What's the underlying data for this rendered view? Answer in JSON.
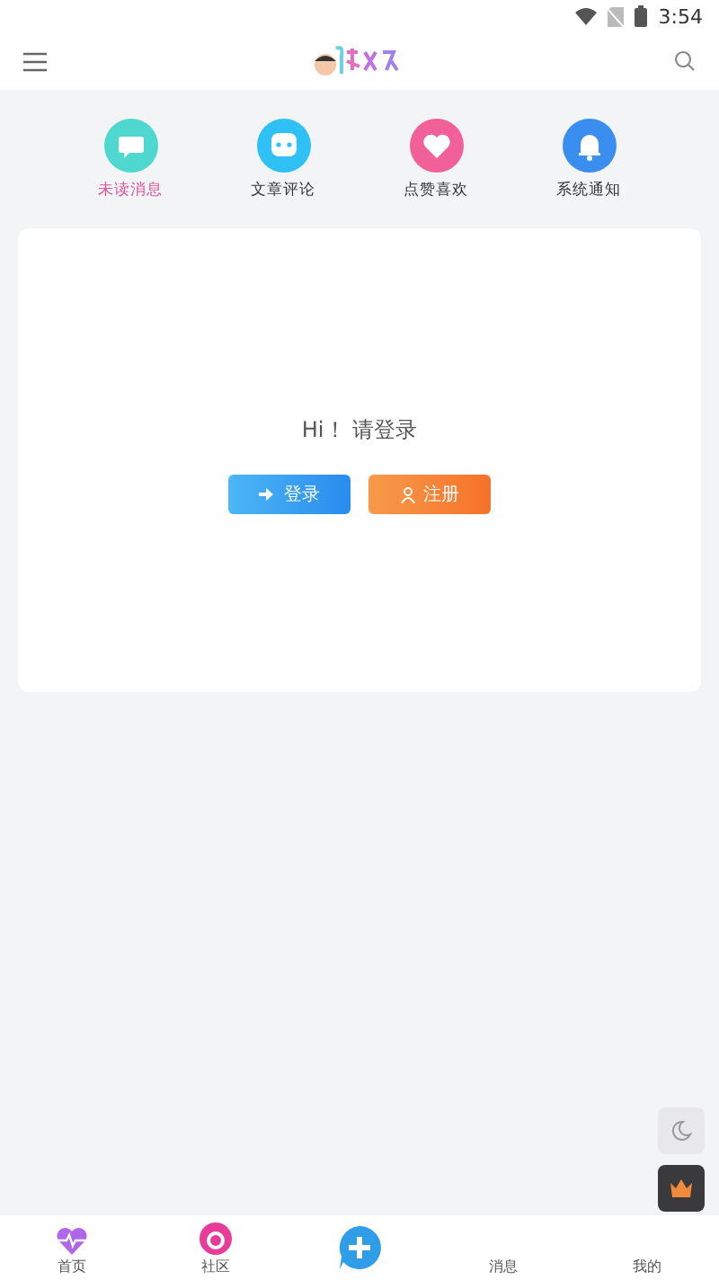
{
  "status_bar": {
    "time": "3:54"
  },
  "shortcuts": [
    {
      "kind": "new",
      "label": "未读消息",
      "selected": true,
      "color": "#4fd8cf"
    },
    {
      "kind": "comment",
      "label": "文章评论",
      "selected": false,
      "color": "#2fc0f5"
    },
    {
      "kind": "like",
      "label": "点赞喜欢",
      "selected": false,
      "color": "#f2609a"
    },
    {
      "kind": "notice",
      "label": "系统通知",
      "selected": false,
      "color": "#3a8ef0"
    }
  ],
  "login_card": {
    "greeting": "Hi！ 请登录",
    "buttons": [
      {
        "kind": "login",
        "label": "登录"
      },
      {
        "kind": "register",
        "label": "注册"
      }
    ]
  },
  "bottom_nav": [
    {
      "kind": "home",
      "label": "首页"
    },
    {
      "kind": "community",
      "label": "社区"
    },
    {
      "kind": "post"
    },
    {
      "kind": "messages",
      "label": "消息"
    },
    {
      "kind": "mine",
      "label": "我的"
    }
  ]
}
